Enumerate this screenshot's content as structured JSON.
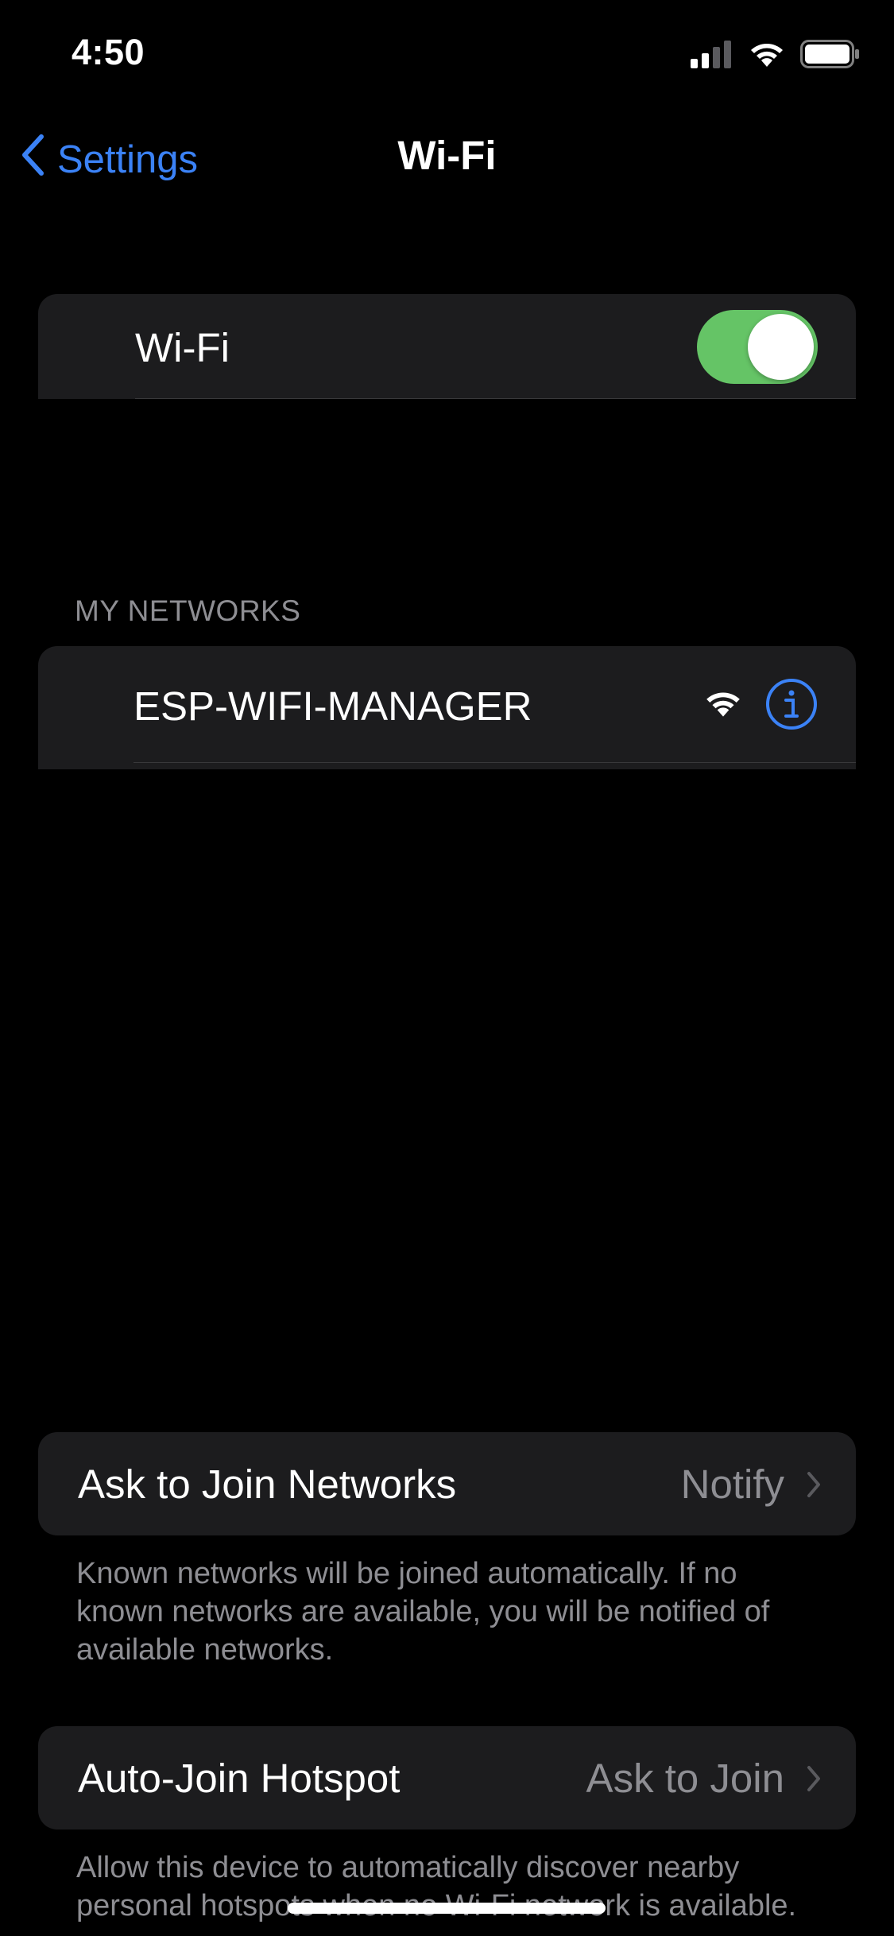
{
  "status_bar": {
    "time": "4:50",
    "icons": [
      "cellular-signal-icon",
      "wifi-icon",
      "battery-icon"
    ]
  },
  "nav": {
    "back_label": "Settings",
    "title": "Wi-Fi"
  },
  "wifi_toggle": {
    "label": "Wi-Fi",
    "on": true
  },
  "my_networks": {
    "header": "MY NETWORKS",
    "networks": [
      {
        "name": "ESP-WIFI-MANAGER",
        "signal_icon": "wifi-signal-icon",
        "info_icon": "info-icon"
      }
    ]
  },
  "ask_to_join": {
    "label": "Ask to Join Networks",
    "value": "Notify",
    "footer": "Known networks will be joined automatically. If no known networks are available, you will be notified of available networks."
  },
  "auto_join_hotspot": {
    "label": "Auto-Join Hotspot",
    "value": "Ask to Join",
    "footer": "Allow this device to automatically discover nearby personal hotspots when no Wi-Fi network is available."
  },
  "colors": {
    "accent": "#3b82f6",
    "toggle_on": "#65c466",
    "cell_bg": "#1c1c1e",
    "secondary_text": "#8e8e93"
  }
}
